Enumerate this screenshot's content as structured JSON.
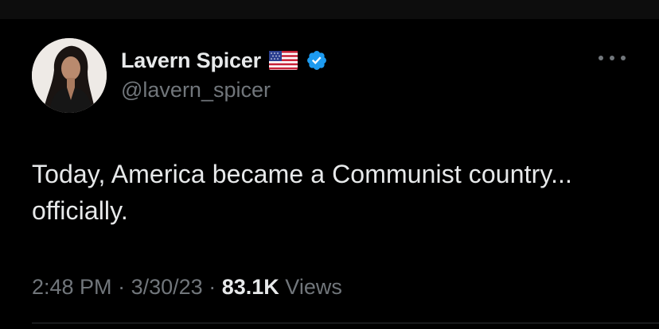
{
  "author": {
    "display_name": "Lavern Spicer",
    "handle": "@lavern_spicer",
    "flag_icon": "us-flag-icon",
    "verified_icon": "verified-badge-icon",
    "verified_color": "#1d9bf0"
  },
  "tweet": {
    "text": "Today, America became a Communist country... officially.",
    "time": "2:48 PM",
    "date": "3/30/23",
    "separator": "·",
    "views_count": "83.1K",
    "views_label": "Views"
  },
  "menu": {
    "icon": "more-options-icon"
  },
  "colors": {
    "background": "#000000",
    "primary_text": "#e7e9ea",
    "secondary_text": "#71767b",
    "accent": "#1d9bf0"
  }
}
